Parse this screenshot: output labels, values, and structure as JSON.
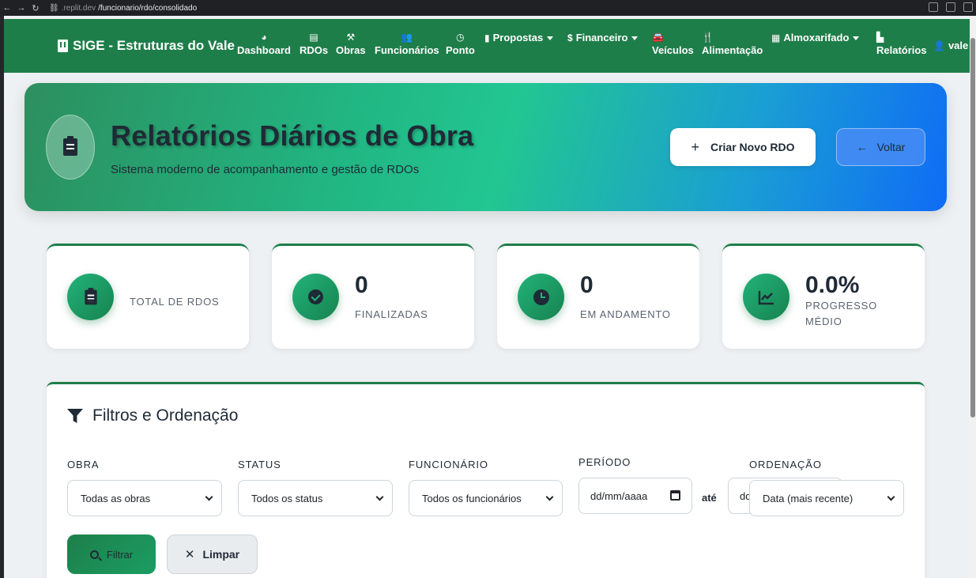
{
  "browser": {
    "url_host": ".replit.dev",
    "url_path": "/funcionario/rdo/consolidado"
  },
  "navbar": {
    "brand": "SIGE - Estruturas do Vale",
    "items": [
      {
        "label": "Dashboard",
        "icon": "gauge-icon"
      },
      {
        "label": "RDOs",
        "icon": "clipboard-icon"
      },
      {
        "label": "Obras",
        "icon": "hammer-icon"
      },
      {
        "label": "Funcionários",
        "icon": "users-icon"
      },
      {
        "label": "Ponto",
        "icon": "clock-icon"
      },
      {
        "label": "Propostas",
        "icon": "file-icon"
      },
      {
        "label": "Financeiro",
        "icon": "dollar-icon"
      },
      {
        "label": "Veículos",
        "icon": "car-icon"
      },
      {
        "label": "Alimentação",
        "icon": "utensils-icon"
      },
      {
        "label": "Almoxarifado",
        "icon": "boxes-icon"
      },
      {
        "label": "Relatórios",
        "icon": "chart-icon"
      },
      {
        "label": "vale",
        "icon": "user-icon"
      }
    ]
  },
  "hero": {
    "title": "Relatórios Diários de Obra",
    "subtitle": "Sistema moderno de acompanhamento e gestão de RDOs",
    "create_button": "Criar Novo RDO",
    "back_button": "Voltar"
  },
  "stats": [
    {
      "value": "",
      "label": "TOTAL DE RDOS"
    },
    {
      "value": "0",
      "label": "FINALIZADAS"
    },
    {
      "value": "0",
      "label": "EM ANDAMENTO"
    },
    {
      "value": "0.0%",
      "label": "PROGRESSO MÉDIO"
    }
  ],
  "filters": {
    "title": "Filtros e Ordenação",
    "obra": {
      "label": "OBRA",
      "value": "Todas as obras"
    },
    "status": {
      "label": "STATUS",
      "value": "Todos os status"
    },
    "funcionario": {
      "label": "FUNCIONÁRIO",
      "value": "Todos os funcionários"
    },
    "periodo": {
      "label": "PERÍODO",
      "from_placeholder": "dd/mm/aaaa",
      "separator": "até",
      "to_placeholder": "dd"
    },
    "ordenacao": {
      "label": "ORDENAÇÃO",
      "value": "Data (mais recente)"
    },
    "filter_button": "Filtrar",
    "clear_button": "Limpar"
  },
  "colors": {
    "primary": "#1e7e4a",
    "hero_gradient_start": "#2c8f5e",
    "hero_gradient_end": "#0f6cf5",
    "text_dark": "#1f2a36"
  }
}
